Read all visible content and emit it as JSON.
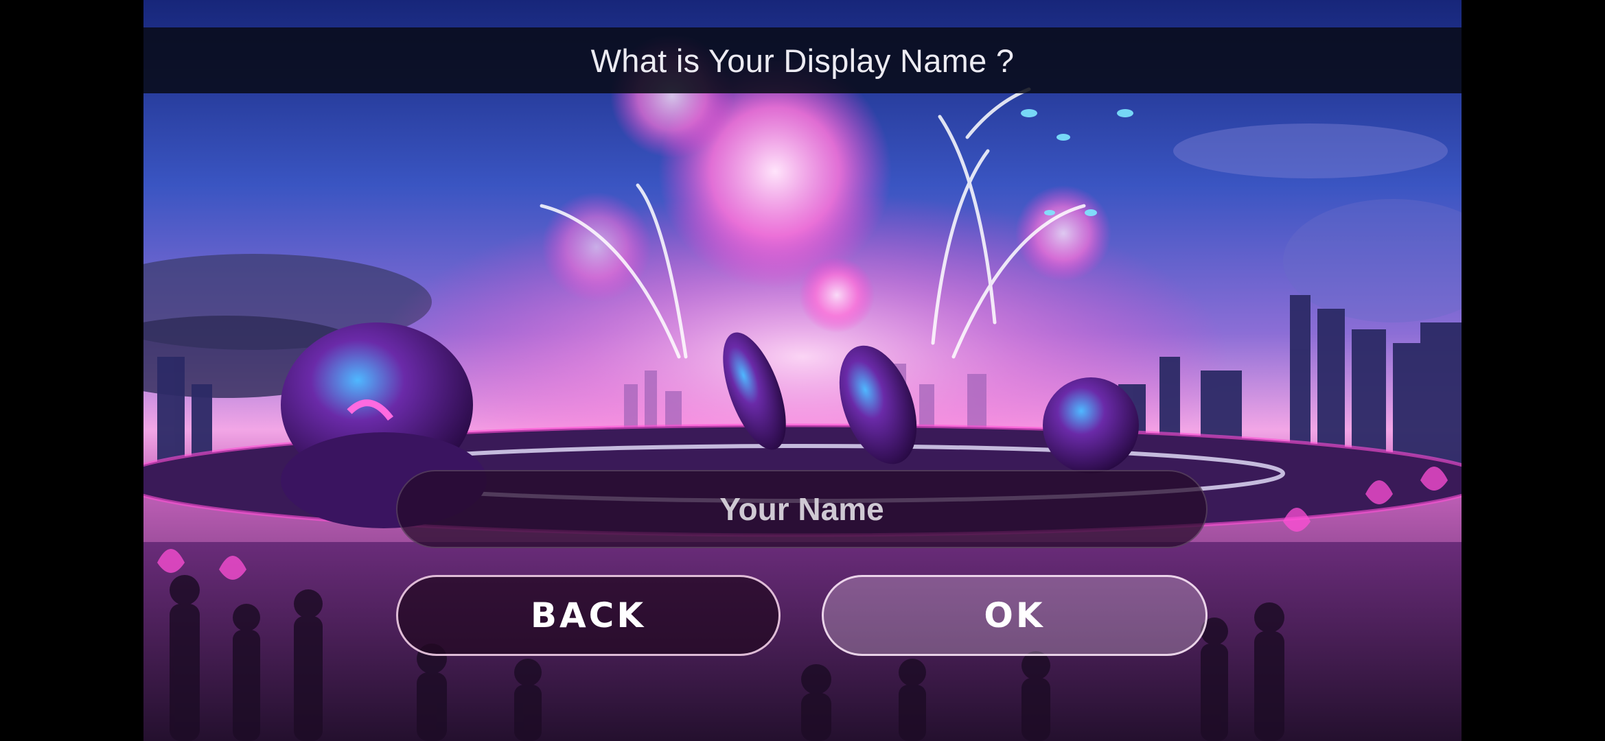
{
  "screen": {
    "title": "What is Your Display Name ?"
  },
  "name_field": {
    "value": "",
    "placeholder": "Your Name"
  },
  "buttons": {
    "back_label": "BACK",
    "ok_label": "OK"
  },
  "colors": {
    "accent_pink": "#ff3fd0",
    "sky_blue": "#3d5fc4",
    "title_bar_bg": "#080a16",
    "title_text": "#ecebf2"
  },
  "icons": {
    "background_scene": "fireworks-city-stadium-illustration"
  }
}
